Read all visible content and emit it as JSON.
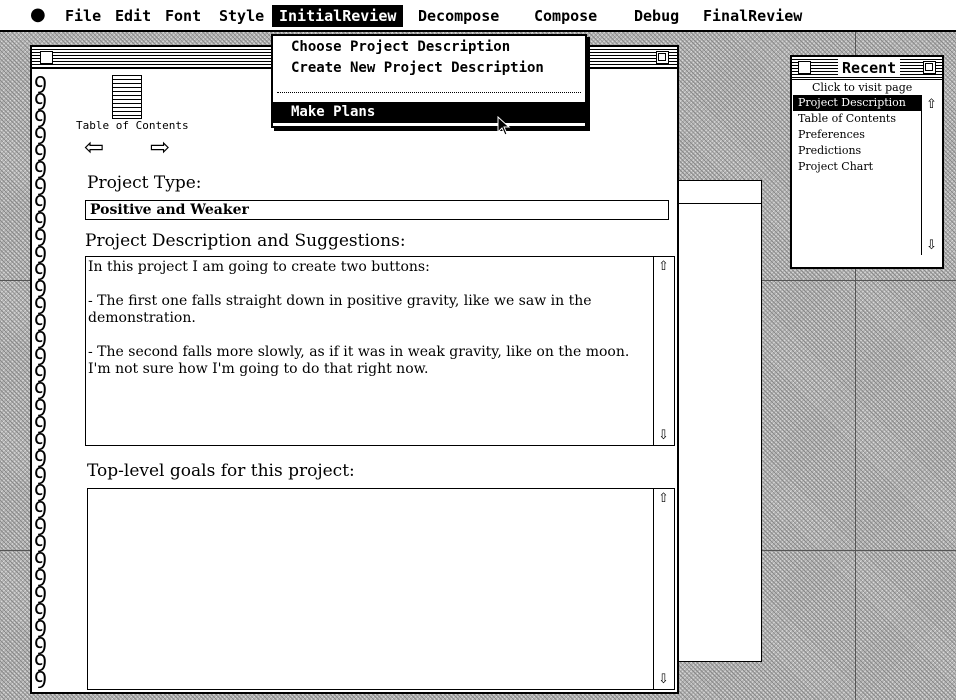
{
  "menubar": {
    "apple": "",
    "items": [
      "File",
      "Edit",
      "Font",
      "Style",
      "InitialReview",
      "Decompose",
      "Compose",
      "Debug",
      "FinalReview"
    ],
    "active": "InitialReview"
  },
  "dropdown": {
    "items": [
      "Choose Project Description",
      "Create New Project Description",
      "Make Plans"
    ],
    "highlighted": "Make Plans"
  },
  "notebook": {
    "toc_label": "Table of Contents",
    "back_arrow": "⇦",
    "forward_arrow": "⇨",
    "project_type_label": "Project Type:",
    "project_type_value": "Positive and Weaker",
    "description_label": "Project Description and Suggestions:",
    "description_text": "In this project I am going to create two buttons:\n\n- The first one falls straight down in positive gravity, like we saw in the demonstration.\n\n- The second falls more slowly, as if it was in weak gravity, like on the moon.  I'm not sure how I'm going to do that right now.",
    "goals_label": "Top-level goals for this project:",
    "goals_text": "",
    "scroll_up_icon": "⇧",
    "scroll_down_icon": "⇩",
    "spiral_glyph": "ꝯ"
  },
  "recent": {
    "title": "Recent",
    "hint": "Click to visit page",
    "items": [
      "Project Description",
      "Table of Contents",
      "Preferences",
      "Predictions",
      "Project Chart"
    ],
    "selected": "Project Description"
  }
}
